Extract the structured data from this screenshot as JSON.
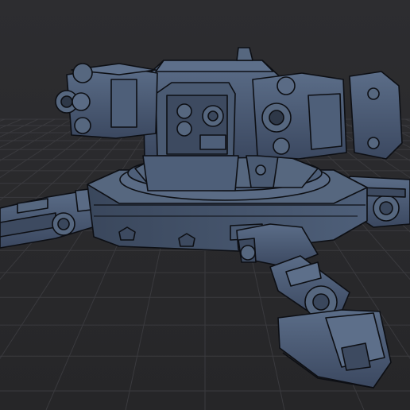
{
  "viewport": {
    "background": "#2a2a2c",
    "grid_color": "#38383b",
    "model_fill": "#4a5a72",
    "model_fill_dark": "#3a475c",
    "model_fill_light": "#5d6f8a",
    "outline": "#0d0f14"
  }
}
